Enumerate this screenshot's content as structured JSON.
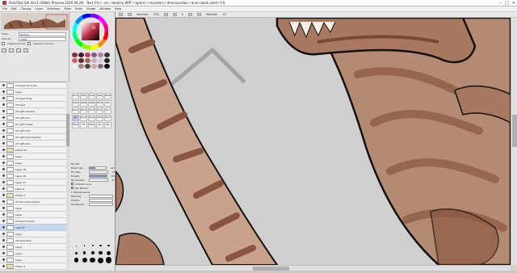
{
  "window": {
    "title": "PaintTool SAI Ver.2 (64bit) Preview.2019.09.26 - Text 1% (- art / sketchy WIP / raptors / monsters / dinosauridae / dunn-dunk.sarm) 1%"
  },
  "menu": [
    "File",
    "Edit",
    "Canvas",
    "Layer",
    "Selection",
    "Filter",
    "Ruler",
    "Shape",
    "Window",
    "Help"
  ],
  "toolbar": {
    "selection_label": "Selection",
    "zoom": "25%",
    "angle": "0",
    "stabilizer_label": "Stabilizer",
    "stabilizer_value": "S3"
  },
  "layer_props": {
    "mode_label": "Mode",
    "mode_value": "Normal",
    "opacity_label": "Opacity",
    "opacity_value": "100%",
    "clipping_label": "Clipping Group",
    "selection_source_label": "Selection Source"
  },
  "layers": [
    {
      "name": "lid head red scale",
      "type": "layer"
    },
    {
      "name": "Layer",
      "type": "layer"
    },
    {
      "name": "lid head body",
      "type": "layer"
    },
    {
      "name": "lid head",
      "type": "layer"
    },
    {
      "name": "lid right shadow",
      "type": "layer"
    },
    {
      "name": "lid right arm",
      "type": "layer"
    },
    {
      "name": "lid right scales",
      "type": "layer"
    },
    {
      "name": "lid right foot",
      "type": "layer"
    },
    {
      "name": "lid right foot shading",
      "type": "layer"
    },
    {
      "name": "lid right arm",
      "type": "layer"
    },
    {
      "name": "Folder 01",
      "type": "folder"
    },
    {
      "name": "Layer",
      "type": "layer"
    },
    {
      "name": "Layer",
      "type": "layer"
    },
    {
      "name": "Layer 16",
      "type": "layer"
    },
    {
      "name": "Layer 16",
      "type": "layer"
    },
    {
      "name": "Layer 17",
      "type": "layer"
    },
    {
      "name": "Layer 8",
      "type": "layer"
    },
    {
      "name": "Folder 2",
      "type": "folder"
    },
    {
      "name": "lid red scale shaded",
      "type": "layer"
    },
    {
      "name": "Layer",
      "type": "layer"
    },
    {
      "name": "Layer",
      "type": "layer"
    },
    {
      "name": "lid head normal",
      "type": "layer"
    },
    {
      "name": "Layer 6",
      "type": "layer"
    },
    {
      "name": "Layer",
      "type": "layer"
    },
    {
      "name": "lid head shes",
      "type": "layer"
    },
    {
      "name": "Layer",
      "type": "layer"
    },
    {
      "name": "Layer",
      "type": "layer"
    },
    {
      "name": "Layer",
      "type": "layer"
    },
    {
      "name": "Folder 3",
      "type": "folder"
    },
    {
      "name": "Layer",
      "type": "layer"
    }
  ],
  "selected_layer_index": 22,
  "swatches": [
    "#8b2a3a",
    "#3a1f2a",
    "#c0405a",
    "#7d5a8a",
    "#b27ea0",
    "#333333",
    "#d95a6a",
    "#6a2a2a",
    "#9a6a5a",
    "#c4b0c0",
    "#e0c8d0",
    "#222222",
    "#f0f0f0",
    "#aa8877",
    "#554433",
    "#ccaaaa",
    "#886688",
    "#000000"
  ],
  "tools": [
    "Pencil",
    "AirBrush",
    "Brush",
    "Water",
    "Marker",
    "Eraser",
    "SelPen",
    "SelErase",
    "Bucket",
    "Blur",
    "Binary",
    "Blend",
    "Smudge",
    "Dodge",
    "Burn",
    "Pen WC",
    "Brush",
    "Marker",
    "Watercolor",
    "Pencil",
    "Pencil2",
    "Fill",
    "Mark",
    "Pen",
    "Pen"
  ],
  "active_tool_index": 15,
  "brush": {
    "mode_label": "Normal",
    "size_label": "Brush Size",
    "size_value": "14.0",
    "min_size_label": "Min Size",
    "min_size_value": "0%",
    "density_label": "Density",
    "density_value": "100",
    "min_density_label": "Min Density",
    "min_density_value": "0%",
    "blending_label": "Blending",
    "dilution_label": "Dilution",
    "persistence_label": "Persistence",
    "smooth_label": "Smooth Curve",
    "tex_label": "Tex Texture",
    "misc_label": "Miscellaneous",
    "size_fill": 0.35,
    "min_size_fill": 0.0,
    "density_fill": 1.0
  },
  "brush_sizes": [
    1,
    1.5,
    2,
    2.3,
    2.6,
    3,
    3.5,
    4,
    4.5,
    5,
    5.5,
    6,
    6.5,
    7,
    7.5
  ]
}
